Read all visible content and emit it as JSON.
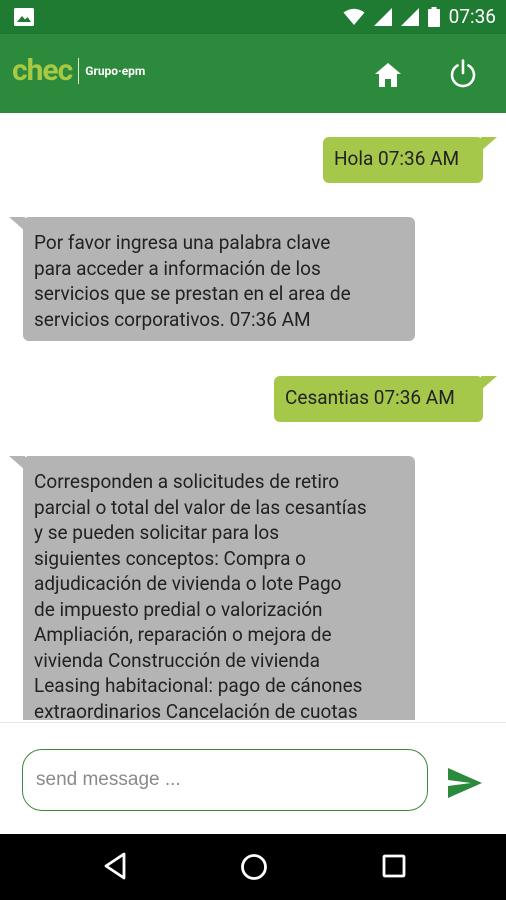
{
  "status_bar": {
    "time": "07:36",
    "icons": [
      "gallery-icon",
      "wifi-icon",
      "signal-icon",
      "signal-icon",
      "battery-icon"
    ]
  },
  "app_bar": {
    "logo_text": "chec",
    "logo_subtext": "Grupo·epm",
    "actions": [
      "home-icon",
      "power-icon"
    ],
    "colors": {
      "primary": "#2b8a3b",
      "status_bar": "#1f7a32",
      "logo_accent": "#a7c944"
    }
  },
  "chat": {
    "colors": {
      "outgoing": "#a5c74a",
      "incoming": "#b4b4b4"
    },
    "messages": [
      {
        "direction": "out",
        "lines": [
          "Hola 07:36 AM"
        ]
      },
      {
        "direction": "in",
        "lines": [
          "Por favor ingresa una palabra clave",
          "para acceder a información de los",
          "servicios que se prestan en el area de",
          "servicios corporativos. 07:36 AM"
        ]
      },
      {
        "direction": "out",
        "lines": [
          "Cesantias 07:36 AM"
        ]
      },
      {
        "direction": "in",
        "lines": [
          "Corresponden a solicitudes de retiro",
          "parcial o total del valor de las cesantías",
          "y se pueden solicitar para los",
          "siguientes conceptos: Compra o",
          "adjudicación de vivienda o lote Pago",
          "de impuesto predial o valorización",
          "Ampliación, reparación o mejora de",
          "vivienda Construcción de vivienda",
          "Leasing habitacional: pago de cánones",
          "extraordinarios Cancelación de cuotas"
        ]
      }
    ]
  },
  "input": {
    "placeholder": "send message ...",
    "value": ""
  },
  "nav_bar": {
    "buttons": [
      "back-icon",
      "home-circle-icon",
      "recents-icon"
    ]
  }
}
